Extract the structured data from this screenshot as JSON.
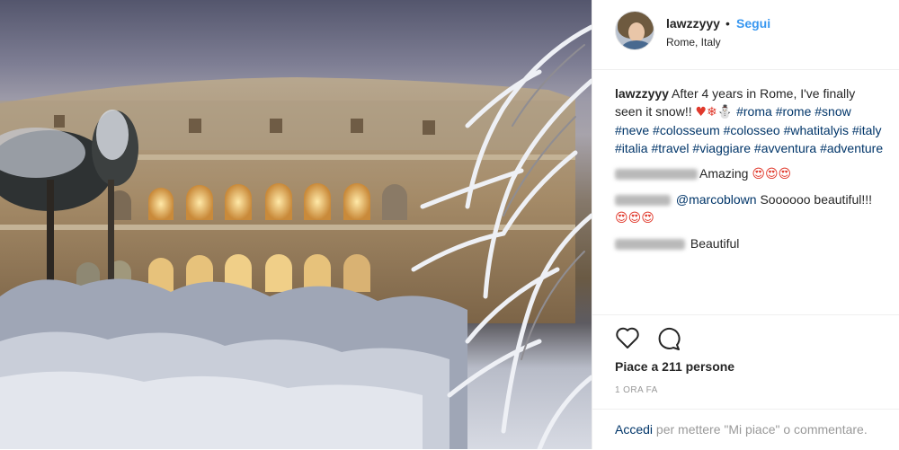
{
  "post": {
    "username": "lawzzyyy",
    "follow_label": "Segui",
    "location": "Rome, Italy",
    "caption": {
      "user": "lawzzyyy",
      "text": " After 4 years in Rome, I've finally seen it snow!! ",
      "symbols": "♥❄⛄",
      "hashtags": [
        "#roma",
        "#rome",
        "#snow",
        "#neve",
        "#colosseum",
        "#colosseo",
        "#whatitalyis",
        "#italy",
        "#italia",
        "#travel",
        "#viaggiare",
        "#avventura",
        "#adventure"
      ]
    },
    "comments": [
      {
        "text": "Amazing",
        "emoji": "😍😍😍"
      },
      {
        "mention": "@marcoblown",
        "text": " Soooooo beautiful!!!",
        "emoji": "😍😍😍"
      },
      {
        "text": "Beautiful"
      }
    ],
    "likes": "Piace a 211 persone",
    "timestamp": "1 ORA FA",
    "login": {
      "link": "Accedi",
      "text": " per mettere \"Mi piace\" o commentare."
    }
  },
  "icons": {
    "like": "heart-icon",
    "comment": "comment-icon"
  },
  "colors": {
    "link": "#3897f0",
    "hashtag": "#003569",
    "muted": "#999999"
  }
}
